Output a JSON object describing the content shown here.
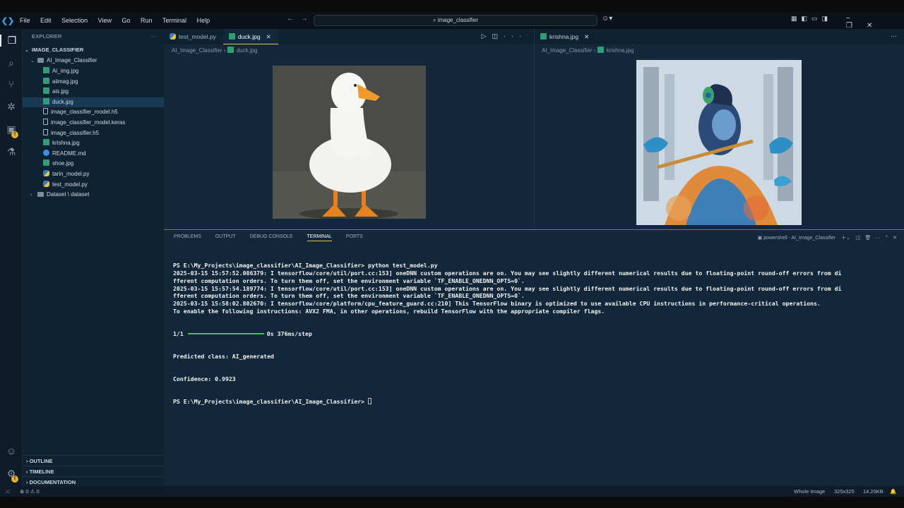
{
  "titlebar": {
    "menu": [
      "File",
      "Edit",
      "Selection",
      "View",
      "Go",
      "Run",
      "Terminal",
      "Help"
    ],
    "search": "image_classifier"
  },
  "sidebar": {
    "header": "EXPLORER",
    "root": "IMAGE_CLASSIFIER",
    "folder": "AI_Image_Classifier",
    "files": [
      {
        "name": "Ai_img.jpg",
        "type": "image"
      },
      {
        "name": "aiimag.jpg",
        "type": "image"
      },
      {
        "name": "ais.jpg",
        "type": "image"
      },
      {
        "name": "duck.jpg",
        "type": "image"
      },
      {
        "name": "image_classifier_model.h5",
        "type": "file"
      },
      {
        "name": "image_classifier_model.keras",
        "type": "file"
      },
      {
        "name": "image_classifier.h5",
        "type": "file"
      },
      {
        "name": "krishna.jpg",
        "type": "image"
      },
      {
        "name": "README.md",
        "type": "info"
      },
      {
        "name": "shoe.jpg",
        "type": "image"
      },
      {
        "name": "tarin_model.py",
        "type": "python"
      },
      {
        "name": "test_model.py",
        "type": "python"
      }
    ],
    "dataset_folder": "Dataset \\ dataset",
    "sections": [
      "OUTLINE",
      "TIMELINE",
      "DOCUMENTATION"
    ]
  },
  "editor_left": {
    "tabs": [
      "test_model.py",
      "duck.jpg"
    ],
    "breadcrumb_root": "AI_Image_Classifier",
    "breadcrumb_file": "duck.jpg"
  },
  "editor_right": {
    "tab": "krishna.jpg",
    "breadcrumb_root": "AI_Image_Classifier",
    "breadcrumb_file": "krishna.jpg"
  },
  "panel": {
    "tabs": [
      "PROBLEMS",
      "OUTPUT",
      "DEBUG CONSOLE",
      "TERMINAL",
      "PORTS"
    ],
    "active_tab": "TERMINAL",
    "shell_label": "powershell - AI_Image_Classifier",
    "terminal_lines": [
      "PS E:\\My_Projects\\image_classifier\\AI_Image_Classifier> python test_model.py",
      "2025-03-15 15:57:52.086379: I tensorflow/core/util/port.cc:153] oneDNN custom operations are on. You may see slightly different numerical results due to floating-point round-off errors from di",
      "fferent computation orders. To turn them off, set the environment variable `TF_ENABLE_ONEDNN_OPTS=0`.",
      "2025-03-15 15:57:54.189774: I tensorflow/core/util/port.cc:153] oneDNN custom operations are on. You may see slightly different numerical results due to floating-point round-off errors from di",
      "fferent computation orders. To turn them off, set the environment variable `TF_ENABLE_ONEDNN_OPTS=0`.",
      "2025-03-15 15:58:02.802670: I tensorflow/core/platform/cpu_feature_guard.cc:210] This TensorFlow binary is optimized to use available CPU instructions in performance-critical operations.",
      "To enable the following instructions: AVX2 FMA, in other operations, rebuild TensorFlow with the appropriate compiler flags."
    ],
    "progress_label": "1/1",
    "progress_suffix": "0s 376ms/step",
    "progress_fraction": 1.0,
    "result_lines": [
      "Predicted class: AI_generated",
      "Confidence: 0.9923"
    ],
    "prompt": "PS E:\\My_Projects\\image_classifier\\AI_Image_Classifier> "
  },
  "status": {
    "problems": "0",
    "warnings": "0",
    "zoom_mode": "Whole Image",
    "dimensions": "325x325",
    "filesize": "14.25KB"
  },
  "colors": {
    "accent": "#e3c24a",
    "progress": "#3fc45a",
    "badge": "#e0b12c"
  }
}
